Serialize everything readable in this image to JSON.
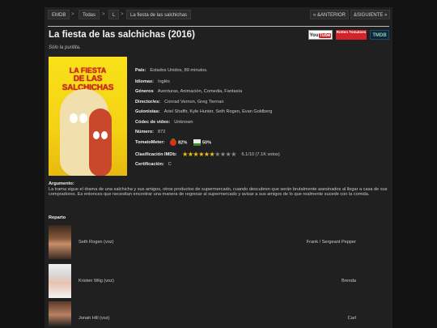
{
  "breadcrumb": [
    "EMDB",
    "Todas",
    "L",
    "La fiesta de las salchichas"
  ],
  "breadcrumb_sep": ">",
  "nav": {
    "prev": "« &ANTERIOR",
    "next": "&SIGUIENTE »"
  },
  "movie": {
    "title": "La fiesta de las salchichas (2016)",
    "tagline": "Sólo la puritita.",
    "poster_text_1": "LA FIESTA",
    "poster_text_2": "DE LAS SALCHICHAS"
  },
  "badges": {
    "youtube_a": "You",
    "youtube_b": "Tube",
    "rotten": "Rotten Tomatoes",
    "tmdb": "TMDB"
  },
  "details": [
    {
      "label": "País:",
      "value": "Estados Unidos, 89 minutos."
    },
    {
      "label": "Idiomas:",
      "value": "Inglés"
    },
    {
      "label": "Géneros",
      "value": "Aventuras, Animación, Comedia, Fantasía"
    },
    {
      "label": "Director/es:",
      "value": "Conrad Vernon, Greg Tiernan"
    },
    {
      "label": "Guionistas:",
      "value": "Ariel Shaffir, Kyle Hunter, Seth Rogen, Evan Goldberg"
    },
    {
      "label": "Códec de vídeo:",
      "value": "Unknown"
    },
    {
      "label": "Número:",
      "value": "872"
    }
  ],
  "tomatometer": {
    "label": "TomatoMeter:",
    "critics": "82%",
    "audience": "50%"
  },
  "imdb": {
    "label": "Clasificación IMDb:",
    "rating": 6.1,
    "text": "6.1/10 (7.1K votos)"
  },
  "certification": {
    "label": "Certificación:",
    "value": "C"
  },
  "argument": {
    "label": "Argumento:",
    "text": "La trama sigue el drama de una salchicha y sus amigos, otros productos de supermercado, cuando descubren que serán brutalmente asesinados al llegar a casa de sus compradores. Es entonces que necesitan encontrar una manera de regresar al supermercado y avisar a sus amigos de lo que realmente sucede con la comida."
  },
  "reparto_label": "Reparto",
  "cast": [
    {
      "actor": "Seth Rogen (voz)",
      "role": "Frank / Sergeant Pepper"
    },
    {
      "actor": "Kristen Wiig (voz)",
      "role": "Brenda"
    },
    {
      "actor": "Jonah Hill (voz)",
      "role": "Carl"
    }
  ],
  "colors": {
    "page_bg": "#121212",
    "panel_bg": "#202020",
    "accent_red": "#d2232a",
    "star": "#f4c20d"
  }
}
